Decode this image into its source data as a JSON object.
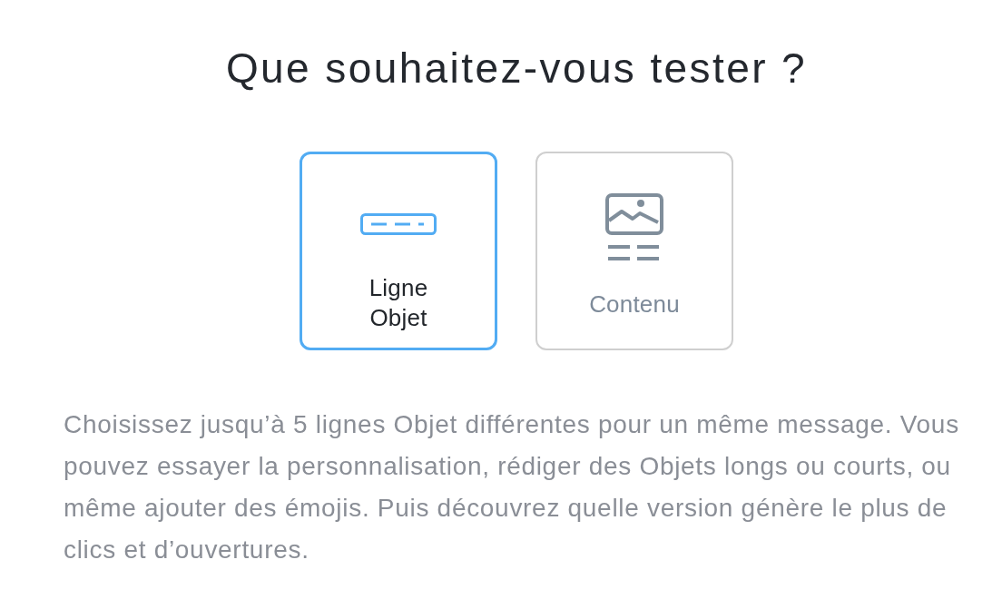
{
  "title": "Que souhaitez-vous tester ?",
  "options": [
    {
      "kind": "subject_line",
      "label": "Ligne Objet",
      "selected": true
    },
    {
      "kind": "content",
      "label": "Contenu",
      "selected": false
    }
  ],
  "description": "Choisissez jusqu’à 5 lignes Objet différentes pour un même message. Vous pouvez essayer la personnalisation, rédiger des Objets longs ou courts, ou même ajouter des émojis. Puis découvrez quelle version génère le plus de clics et d’ouvertures."
}
